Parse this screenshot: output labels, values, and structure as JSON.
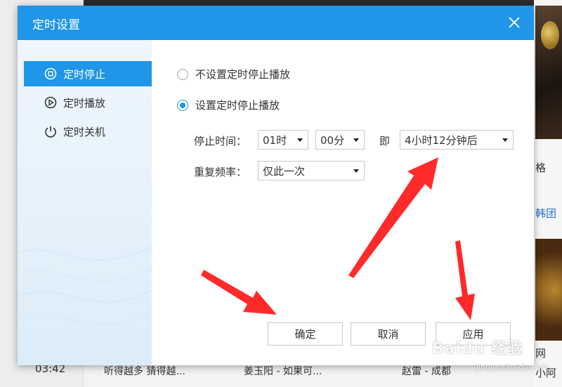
{
  "background": {
    "time": "03:42",
    "songs": [
      "听得越多 猜得越...",
      "姜玉阳 - 如果可...",
      "赵雷 - 成都"
    ],
    "right_texts": [
      "格",
      "韩团",
      "网",
      "小阿"
    ]
  },
  "watermark": {
    "brand": "Baidu 经验",
    "sub": "jingyan.baidu.com"
  },
  "dialog": {
    "title": "定时设置",
    "sidebar": {
      "items": [
        {
          "label": "定时停止",
          "icon": "timer-stop-icon",
          "active": true
        },
        {
          "label": "定时播放",
          "icon": "timer-play-icon",
          "active": false
        },
        {
          "label": "定时关机",
          "icon": "power-icon",
          "active": false
        }
      ]
    },
    "options": {
      "no_timer_label": "不设置定时停止播放",
      "set_timer_label": "设置定时停止播放",
      "selected": "set_timer"
    },
    "stop_time": {
      "label": "停止时间：",
      "hour": "01时",
      "minute": "00分",
      "ji_label": "即",
      "after": "4小时12分钟后"
    },
    "repeat": {
      "label": "重复频率：",
      "value": "仅此一次"
    },
    "buttons": {
      "ok": "确定",
      "cancel": "取消",
      "apply": "应用"
    }
  },
  "colors": {
    "accent": "#1f96e8",
    "annotation_arrow": "#ff2a2a"
  }
}
